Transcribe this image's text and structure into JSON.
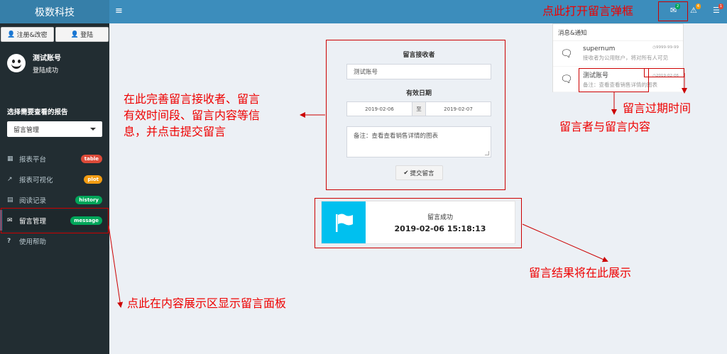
{
  "app": {
    "title": "极数科技"
  },
  "sidebar": {
    "register_label": "注册&改密",
    "login_label": "登陆",
    "user_name": "测试账号",
    "user_status": "登陆成功",
    "report_label": "选择需要查看的报告",
    "report_selected": "留言管理",
    "items": [
      {
        "label": "报表平台",
        "badge": "table",
        "icon": "table-icon"
      },
      {
        "label": "报表可视化",
        "badge": "plot",
        "icon": "line-chart-icon"
      },
      {
        "label": "阅读记录",
        "badge": "history",
        "icon": "book-icon"
      },
      {
        "label": "留言管理",
        "badge": "message",
        "icon": "envelope-icon"
      },
      {
        "label": "使用帮助",
        "badge": "",
        "icon": "question-icon"
      }
    ]
  },
  "header": {
    "messages_count": "2",
    "warnings_count": "4",
    "tasks_count": "1"
  },
  "dropdown": {
    "title": "消息&通知",
    "items": [
      {
        "title": "supernum",
        "desc": "接收者为公用账户，将对所有人可见",
        "time": "9999-99-99"
      },
      {
        "title": "测试账号",
        "desc": "备注：查看查看销售详情的图表",
        "time": "2019-02-06"
      }
    ]
  },
  "form": {
    "recipient_label": "留言接收者",
    "recipient_value": "测试账号",
    "date_label": "有效日期",
    "date_from": "2019-02-06",
    "date_sep": "至",
    "date_to": "2019-02-07",
    "message": "备注：查看查看销售详情的图表",
    "submit_label": "提交留言"
  },
  "result": {
    "title": "留言成功",
    "timestamp": "2019-02-06 15:18:13"
  },
  "annotations": {
    "open_popup": "点此打开留言弹框",
    "form_hint_1": "在此完善留言接收者、留言",
    "form_hint_2": "有效时间段、留言内容等信",
    "form_hint_3": "息，并点击提交留言",
    "expiry": "留言过期时间",
    "sender_content": "留言者与留言内容",
    "result_shown": "留言结果将在此展示",
    "sidebar_hint": "点此在内容展示区显示留言面板"
  },
  "colors": {
    "header": "#3c8dbc",
    "logo": "#367fa9",
    "sidebar": "#222d32",
    "annotation": "#e00000",
    "info_box": "#00c0ef"
  }
}
